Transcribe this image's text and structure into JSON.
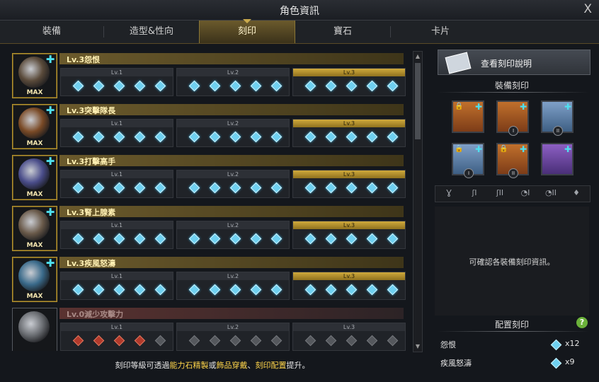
{
  "window": {
    "title": "角色資訊",
    "close": "X"
  },
  "tabs": [
    {
      "label": "裝備"
    },
    {
      "label": "造型&性向"
    },
    {
      "label": "刻印",
      "active": true
    },
    {
      "label": "寶石"
    },
    {
      "label": "卡片"
    }
  ],
  "engravings": [
    {
      "name": "Lv.3怨恨",
      "badge": "MAX",
      "active_level": 3,
      "gems": [
        [
          "blue",
          "blue",
          "blue",
          "blue",
          "blue"
        ],
        [
          "blue",
          "blue",
          "blue",
          "blue",
          "blue"
        ],
        [
          "blue",
          "blue",
          "blue",
          "blue",
          "blue"
        ]
      ],
      "orb_color": "#5a4a3a"
    },
    {
      "name": "Lv.3突擊隊長",
      "badge": "MAX",
      "active_level": 3,
      "gems": [
        [
          "blue",
          "blue",
          "blue",
          "blue",
          "blue"
        ],
        [
          "blue",
          "blue",
          "blue",
          "blue",
          "blue"
        ],
        [
          "blue",
          "blue",
          "blue",
          "blue",
          "blue"
        ]
      ],
      "orb_color": "#7a4a26"
    },
    {
      "name": "Lv.3打擊高手",
      "badge": "MAX",
      "active_level": 3,
      "gems": [
        [
          "blue",
          "blue",
          "blue",
          "blue",
          "blue"
        ],
        [
          "blue",
          "blue",
          "blue",
          "blue",
          "blue"
        ],
        [
          "blue",
          "blue",
          "blue",
          "blue",
          "blue"
        ]
      ],
      "orb_color": "#4a4d8a"
    },
    {
      "name": "Lv.3腎上腺素",
      "badge": "MAX",
      "active_level": 3,
      "gems": [
        [
          "blue",
          "blue",
          "blue",
          "blue",
          "blue"
        ],
        [
          "blue",
          "blue",
          "blue",
          "blue",
          "blue"
        ],
        [
          "blue",
          "blue",
          "blue",
          "blue",
          "blue"
        ]
      ],
      "orb_color": "#6a5a4a"
    },
    {
      "name": "Lv.3疾風怒濤",
      "badge": "MAX",
      "active_level": 3,
      "gems": [
        [
          "blue",
          "blue",
          "blue",
          "blue",
          "blue"
        ],
        [
          "blue",
          "blue",
          "blue",
          "blue",
          "blue"
        ],
        [
          "blue",
          "blue",
          "blue",
          "blue",
          "blue"
        ]
      ],
      "orb_color": "#3a6a8a"
    },
    {
      "name": "Lv.0減少攻擊力",
      "badge": "",
      "active_level": 0,
      "gems": [
        [
          "red",
          "red",
          "red",
          "red",
          "off"
        ],
        [
          "off",
          "off",
          "off",
          "off",
          "off"
        ],
        [
          "off",
          "off",
          "off",
          "off",
          "off"
        ]
      ],
      "orb_color": "#6a6d72"
    }
  ],
  "level_labels": [
    "Lv.1",
    "Lv.2",
    "Lv.3"
  ],
  "footer": {
    "p1": "刻印等級可透過",
    "h1": "能力石精製",
    "p2": "或",
    "h2": "飾品穿戴",
    "p3": "、",
    "h3": "刻印配置",
    "p4": "提升。"
  },
  "right": {
    "view_button": "查看刻印說明",
    "equip_header": "裝備刻印",
    "equip_items": [
      {
        "icon": "helmet-icon",
        "locked": true,
        "rank": "",
        "color": "orange"
      },
      {
        "icon": "ring-icon",
        "locked": false,
        "rank": "I",
        "color": "orange"
      },
      {
        "icon": "crystal-icon",
        "locked": false,
        "rank": "II",
        "color": "blue2"
      },
      {
        "icon": "ring-icon",
        "locked": true,
        "rank": "I",
        "color": "blue2"
      },
      {
        "icon": "ring-icon",
        "locked": true,
        "rank": "II",
        "color": "orange"
      },
      {
        "icon": "stone-icon",
        "locked": false,
        "rank": "",
        "color": "purple"
      }
    ],
    "slot_filters": [
      {
        "icon": "necklace-icon",
        "text": "Ɣ"
      },
      {
        "icon": "earring-1-icon",
        "text": "ʃI"
      },
      {
        "icon": "earring-2-icon",
        "text": "ʃII"
      },
      {
        "icon": "ring-1-icon",
        "text": "◔I"
      },
      {
        "icon": "ring-2-icon",
        "text": "◔II"
      },
      {
        "icon": "stone-filter-icon",
        "text": "♦"
      }
    ],
    "info_text": "可確認各裝備刻印資訊。",
    "config_header": "配置刻印",
    "help": "?",
    "config": [
      {
        "name": "怨恨",
        "count": "x12"
      },
      {
        "name": "疾風怒濤",
        "count": "x9"
      }
    ]
  }
}
